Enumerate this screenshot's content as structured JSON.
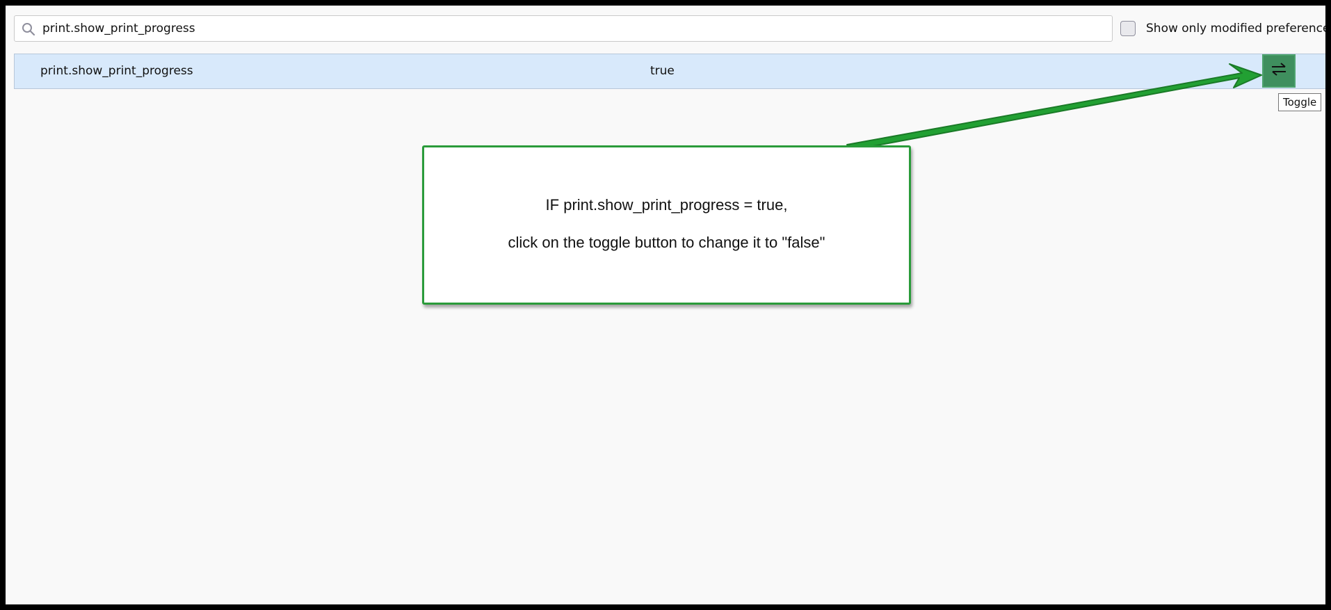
{
  "search": {
    "value": "print.show_print_progress",
    "icon": "search-icon"
  },
  "filter": {
    "show_modified_label": "Show only modified preferences",
    "checked": false
  },
  "preference": {
    "name": "print.show_print_progress",
    "value": "true"
  },
  "toggle": {
    "icon": "swap-arrows-icon",
    "tooltip": "Toggle"
  },
  "callout": {
    "line1": "IF print.show_print_progress = true,",
    "line2": "click on the toggle button to change it to \"false\""
  },
  "colors": {
    "row_highlight": "#d8e9fb",
    "toggle_background": "#3f8f5e",
    "callout_border": "#2a9b3a"
  }
}
